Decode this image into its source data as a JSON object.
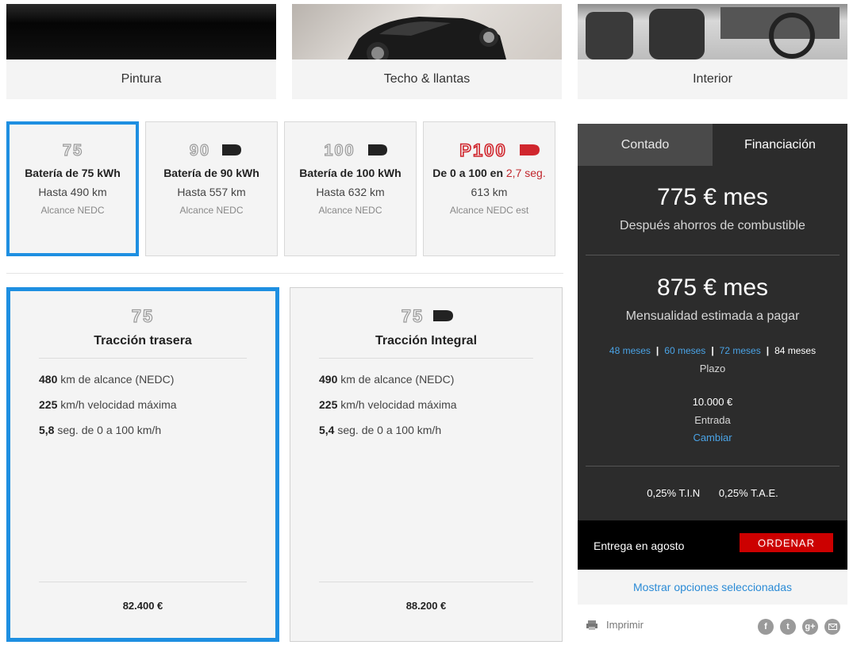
{
  "categories": [
    {
      "label": "Pintura"
    },
    {
      "label": "Techo & llantas"
    },
    {
      "label": "Interior"
    }
  ],
  "batteries": [
    {
      "badge": "75",
      "title": "Batería de 75 kWh",
      "range": "Hasta 490 km",
      "note": "Alcance NEDC",
      "selected": true
    },
    {
      "badge": "90D",
      "title": "Batería de 90 kWh",
      "range": "Hasta 557 km",
      "note": "Alcance NEDC",
      "selected": false
    },
    {
      "badge": "100D",
      "title": "Batería de 100 kWh",
      "range": "Hasta 632 km",
      "note": "Alcance NEDC",
      "selected": false
    },
    {
      "badge": "P100D",
      "title_pre": "De 0 a 100 en",
      "title_red": "2,7 seg.",
      "range": "613 km",
      "note": "Alcance NEDC est",
      "selected": false
    }
  ],
  "drives": [
    {
      "badge": "75",
      "title": "Tracción trasera",
      "specs": [
        {
          "value": "480",
          "text": "km de alcance (NEDC)"
        },
        {
          "value": "225",
          "text": "km/h velocidad máxima"
        },
        {
          "value": "5,8",
          "text": "seg. de 0 a 100 km/h"
        }
      ],
      "price": "82.400 €",
      "selected": true
    },
    {
      "badge": "75D",
      "title": "Tracción Integral",
      "specs": [
        {
          "value": "490",
          "text": "km de alcance (NEDC)"
        },
        {
          "value": "225",
          "text": "km/h velocidad máxima"
        },
        {
          "value": "5,4",
          "text": "seg. de 0 a 100 km/h"
        }
      ],
      "price": "88.200 €",
      "selected": false
    }
  ],
  "finance": {
    "tabs": [
      {
        "label": "Contado",
        "active": false
      },
      {
        "label": "Financiación",
        "active": true
      }
    ],
    "savings_amount": "775 € mes",
    "savings_label": "Después ahorros de combustible",
    "monthly_amount": "875 € mes",
    "monthly_label": "Mensualidad estimada a pagar",
    "terms": [
      {
        "label": "48 meses",
        "active": false
      },
      {
        "label": "60 meses",
        "active": false
      },
      {
        "label": "72 meses",
        "active": false
      },
      {
        "label": "84 meses",
        "active": true
      }
    ],
    "term_caption": "Plazo",
    "downpayment": "10.000 €",
    "downpayment_label": "Entrada",
    "change_label": "Cambiar",
    "tin": "0,25% T.I.N",
    "tae": "0,25% T.A.E.",
    "delivery": "Entrega en agosto",
    "order_label": "ORDENAR"
  },
  "show_options": "Mostrar opciones seleccionadas",
  "print_label": "Imprimir",
  "social_icons": [
    "facebook-icon",
    "twitter-icon",
    "google-plus-icon",
    "email-icon"
  ],
  "colors": {
    "accent_blue": "#1e8fe1",
    "order_red": "#cc0000",
    "panel_dark": "#2c2c2c",
    "badge_red": "#c1272d"
  }
}
